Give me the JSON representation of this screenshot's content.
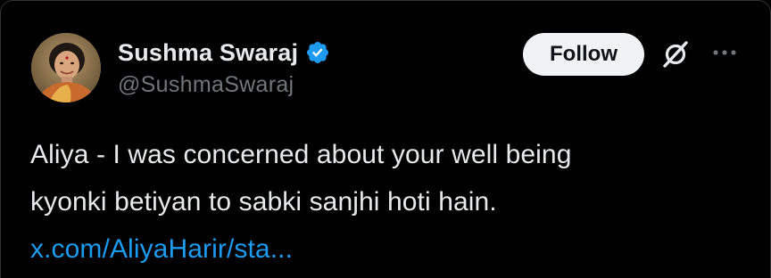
{
  "author": {
    "display_name": "Sushma Swaraj",
    "handle": "@SushmaSwaraj",
    "verified": true
  },
  "actions": {
    "follow_label": "Follow"
  },
  "tweet": {
    "line1": "Aliya - I was concerned about your well being",
    "line2": "kyonki betiyan to sabki sanjhi hoti hain.",
    "link": "x.com/AliyaHarir/sta..."
  },
  "icons": {
    "verified": "verified-badge-icon",
    "x_logo": "x-logo-icon",
    "more": "more-options-icon"
  },
  "colors": {
    "background": "#000000",
    "text": "#e7e9ea",
    "secondary_text": "#71767b",
    "link": "#1d9bf0",
    "verified_badge": "#1d9bf0",
    "follow_button_bg": "#eff3f4",
    "follow_button_text": "#0f1419"
  }
}
